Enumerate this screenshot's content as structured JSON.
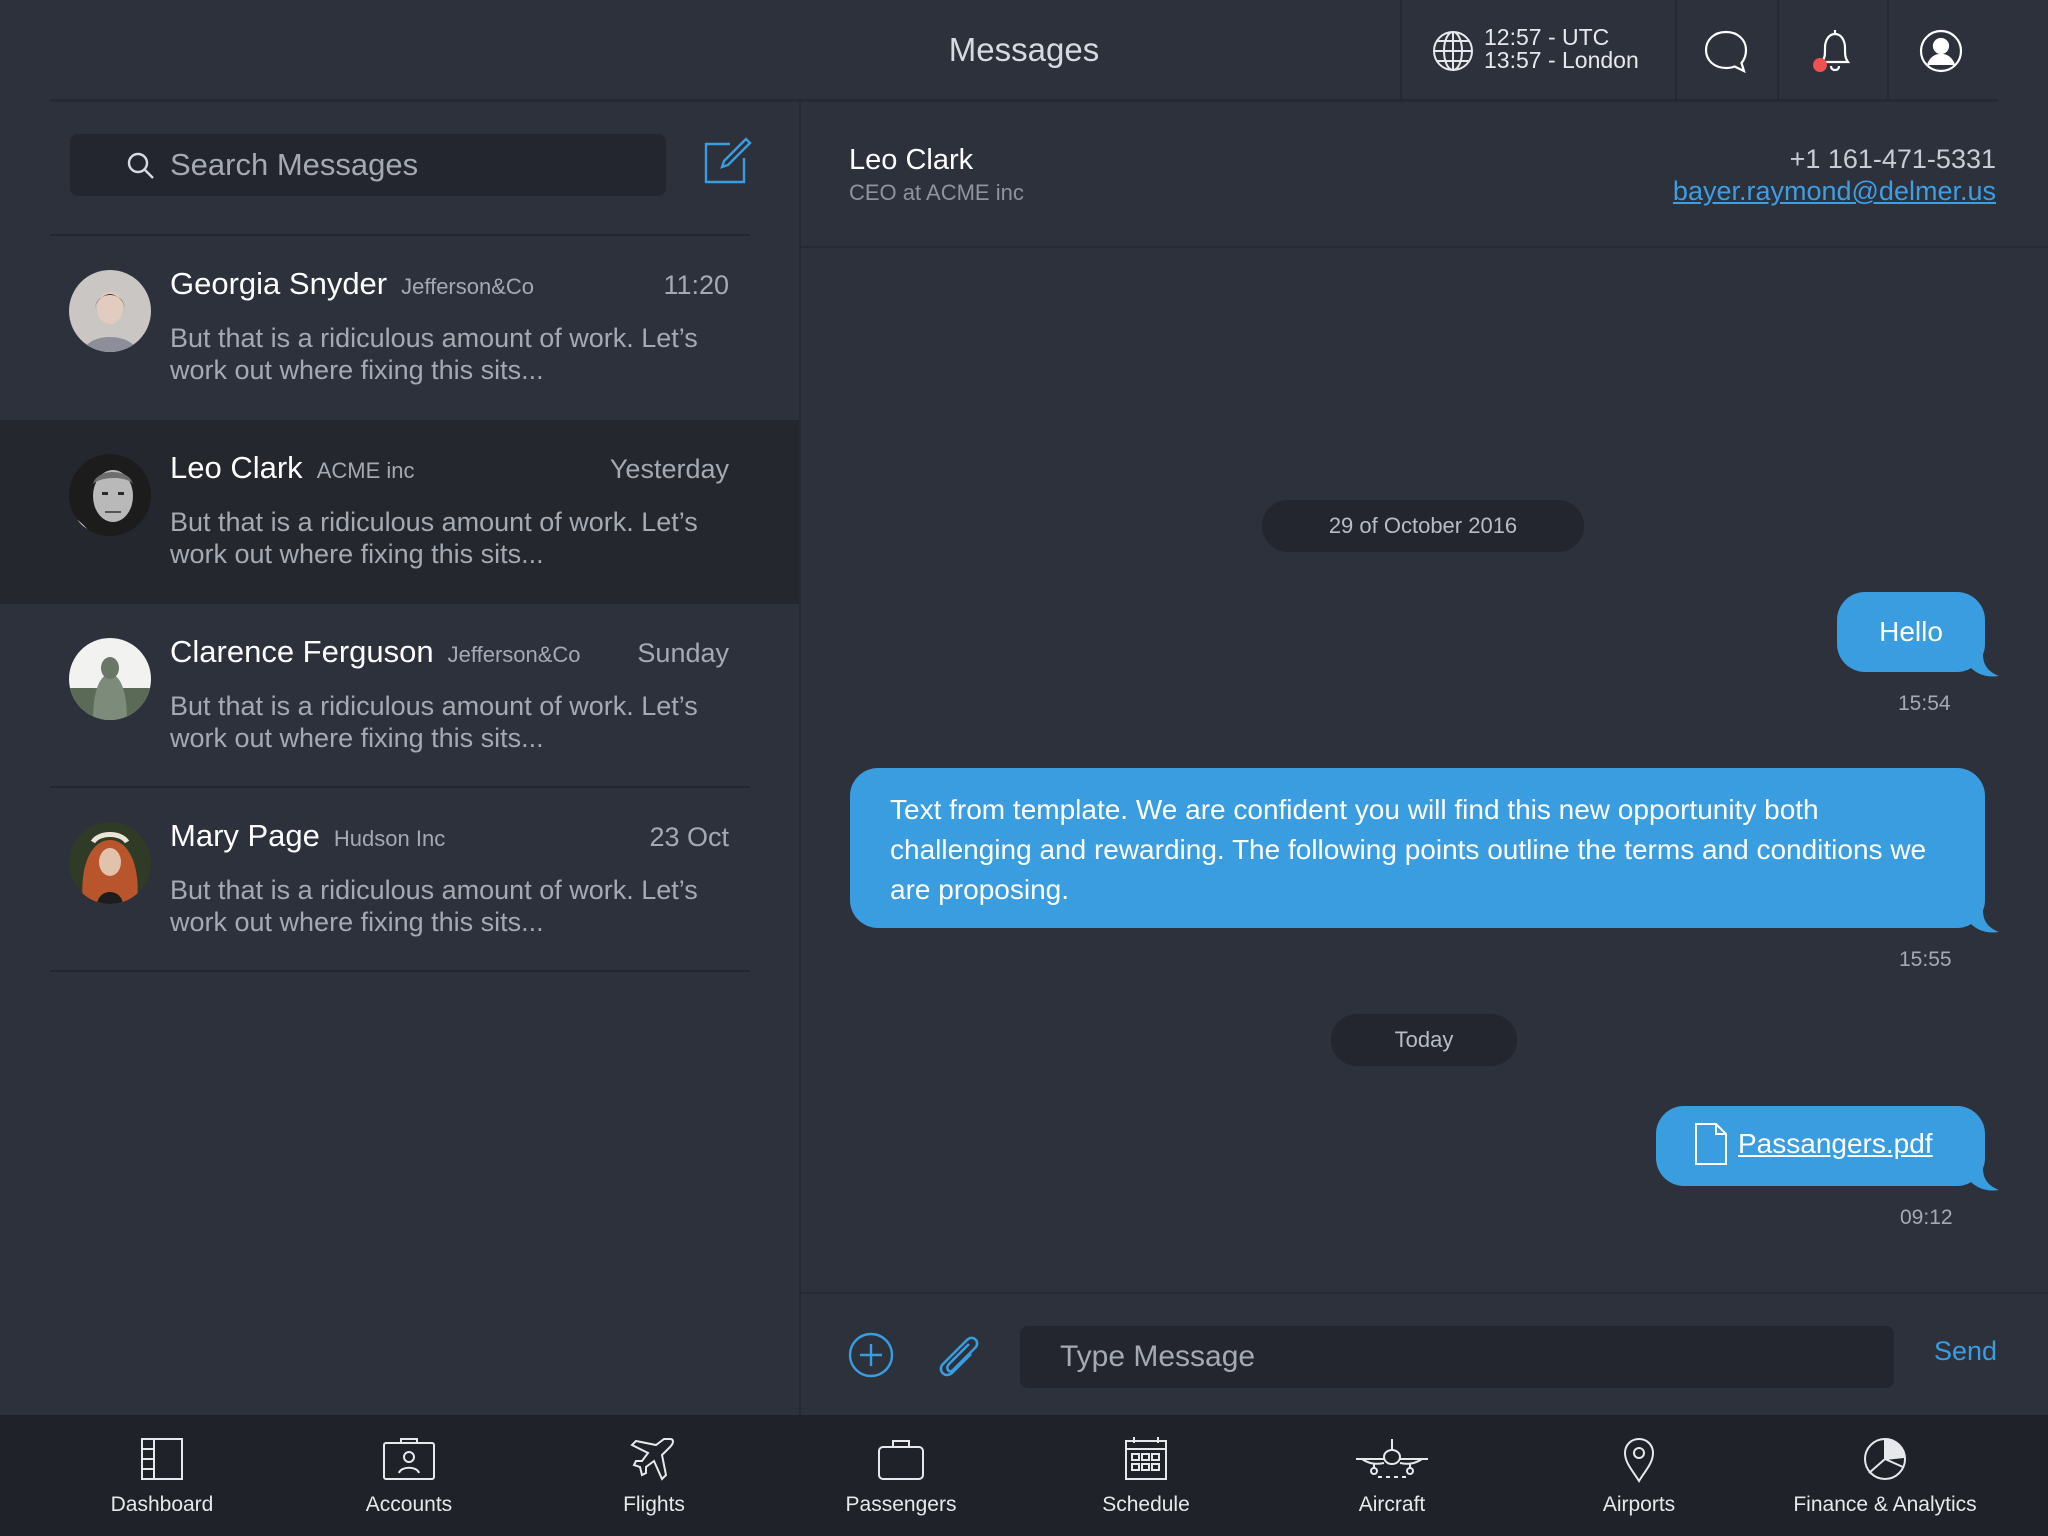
{
  "header": {
    "title": "Messages",
    "utc_time": "12:57 - UTC",
    "local_time": "13:57 - London",
    "notification_dot_color": "#f0504f"
  },
  "search": {
    "placeholder": "Search Messages"
  },
  "conversations": [
    {
      "name": "Georgia Snyder",
      "company": "Jefferson&Co",
      "time": "11:20",
      "preview": "But that is a ridiculous amount of work. Let’s work out where fixing this sits...",
      "selected": false
    },
    {
      "name": "Leo Clark",
      "company": "ACME inc",
      "time": "Yesterday",
      "preview": "But that is a ridiculous amount of work. Let’s work out where fixing this sits...",
      "selected": true
    },
    {
      "name": "Clarence Ferguson",
      "company": "Jefferson&Co",
      "time": "Sunday",
      "preview": "But that is a ridiculous amount of work. Let’s work out where fixing this sits...",
      "selected": false
    },
    {
      "name": "Mary Page",
      "company": "Hudson Inc",
      "time": "23 Oct",
      "preview": "But that is a ridiculous amount of work. Let’s work out where fixing this sits...",
      "selected": false
    }
  ],
  "contact": {
    "name": "Leo Clark",
    "title": "CEO at ACME inc",
    "phone": "+1 161-471-5331",
    "email": "bayer.raymond@delmer.us"
  },
  "thread": {
    "date_divider_1": "29 of October 2016",
    "message_1": {
      "text": "Hello",
      "time": "15:54"
    },
    "message_2": {
      "text": "Text from template. We are confident you will find this new opportunity both challenging and rewarding. The following points outline the terms and conditions we are proposing.",
      "time": "15:55"
    },
    "date_divider_2": "Today",
    "message_3": {
      "file_name": "Passangers.pdf",
      "time": "09:12"
    }
  },
  "composer": {
    "placeholder": "Type Message",
    "send_label": "Send"
  },
  "tabbar": {
    "items": [
      {
        "label": "Dashboard",
        "icon": "dashboard-icon"
      },
      {
        "label": "Accounts",
        "icon": "accounts-icon"
      },
      {
        "label": "Flights",
        "icon": "airplane-icon"
      },
      {
        "label": "Passengers",
        "icon": "briefcase-icon"
      },
      {
        "label": "Schedule",
        "icon": "calendar-icon"
      },
      {
        "label": "Aircraft",
        "icon": "aircraft-icon"
      },
      {
        "label": "Airports",
        "icon": "map-pin-icon"
      },
      {
        "label": "Finance & Analytics",
        "icon": "pie-chart-icon"
      }
    ]
  },
  "colors": {
    "background": "#2d313b",
    "accent": "#3a9de0",
    "tabbar": "#1f2228"
  }
}
